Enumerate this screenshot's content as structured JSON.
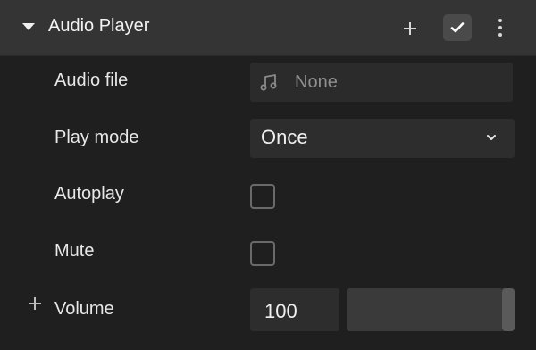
{
  "panel": {
    "title": "Audio Player",
    "enabled": true
  },
  "fields": {
    "audio_file": {
      "label": "Audio file",
      "value": "None"
    },
    "play_mode": {
      "label": "Play mode",
      "value": "Once"
    },
    "autoplay": {
      "label": "Autoplay",
      "checked": false
    },
    "mute": {
      "label": "Mute",
      "checked": false
    },
    "volume": {
      "label": "Volume",
      "value": "100",
      "level": 1.0
    }
  },
  "icons": {
    "collapse": "caret-down-icon",
    "add": "plus-icon",
    "enabled": "check-icon",
    "more": "more-vertical-icon",
    "audio": "music-note-icon",
    "dropdown": "chevron-down-icon"
  },
  "colors": {
    "background": "#1f1f1f",
    "header": "#343434",
    "field": "#2b2b2b"
  }
}
